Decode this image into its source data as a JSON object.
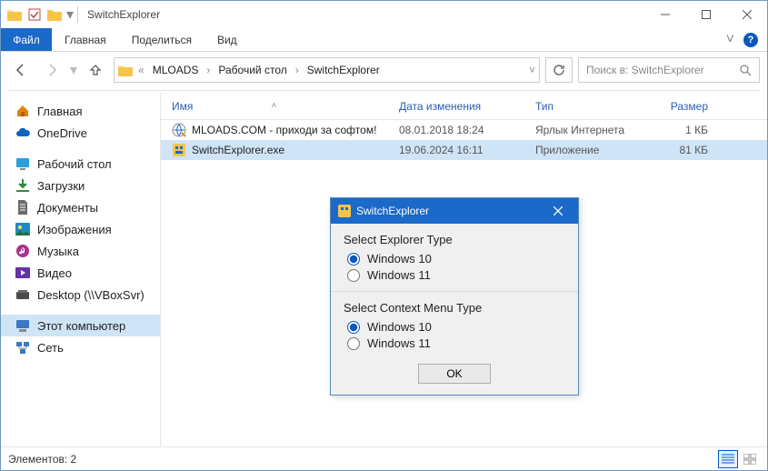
{
  "titlebar": {
    "title": "SwitchExplorer"
  },
  "ribbon": {
    "file": "Файл",
    "tabs": [
      "Главная",
      "Поделиться",
      "Вид"
    ],
    "chevron": "˅"
  },
  "nav": {
    "crumbs": [
      "MLOADS",
      "Рабочий стол",
      "SwitchExplorer"
    ],
    "prefix": "«"
  },
  "search": {
    "placeholder": "Поиск в: SwitchExplorer"
  },
  "sidebar": {
    "items": [
      {
        "label": "Главная",
        "icon": "home",
        "color": "#e3820f"
      },
      {
        "label": "OneDrive",
        "icon": "cloud",
        "color": "#0a64c2"
      }
    ],
    "places": [
      {
        "label": "Рабочий стол",
        "icon": "desktop",
        "color": "#2aa0da"
      },
      {
        "label": "Загрузки",
        "icon": "download",
        "color": "#2e8b3d"
      },
      {
        "label": "Документы",
        "icon": "document",
        "color": "#6b6b6b"
      },
      {
        "label": "Изображения",
        "icon": "picture",
        "color": "#1f8bc4"
      },
      {
        "label": "Музыка",
        "icon": "music",
        "color": "#a8328c"
      },
      {
        "label": "Видео",
        "icon": "video",
        "color": "#6532a8"
      },
      {
        "label": "Desktop (\\\\VBoxSvr)",
        "icon": "netfolder",
        "color": "#4a4a4a"
      }
    ],
    "system": [
      {
        "label": "Этот компьютер",
        "icon": "pc",
        "color": "#3a78c2",
        "selected": true
      },
      {
        "label": "Сеть",
        "icon": "network",
        "color": "#3a78c2"
      }
    ]
  },
  "columns": {
    "name": "Имя",
    "date": "Дата изменения",
    "type": "Тип",
    "size": "Размер"
  },
  "rows": [
    {
      "name": "MLOADS.COM - приходи за софтом!",
      "date": "08.01.2018 18:24",
      "type": "Ярлык Интернета",
      "size": "1 КБ",
      "icon": "web",
      "selected": false
    },
    {
      "name": "SwitchExplorer.exe",
      "date": "19.06.2024 16:11",
      "type": "Приложение",
      "size": "81 КБ",
      "icon": "app",
      "selected": true
    }
  ],
  "status": {
    "text": "Элементов: 2"
  },
  "dialog": {
    "title": "SwitchExplorer",
    "groups": [
      {
        "label": "Select Explorer Type",
        "options": [
          "Windows 10",
          "Windows 11"
        ],
        "selected": 0
      },
      {
        "label": "Select Context Menu Type",
        "options": [
          "Windows 10",
          "Windows 11"
        ],
        "selected": 0
      }
    ],
    "ok": "OK"
  }
}
